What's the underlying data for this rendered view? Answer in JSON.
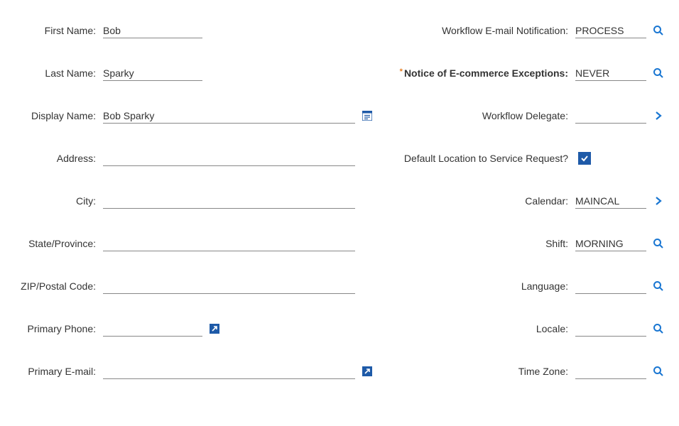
{
  "left": {
    "first_name": {
      "label": "First Name:",
      "value": "Bob"
    },
    "last_name": {
      "label": "Last Name:",
      "value": "Sparky"
    },
    "display_name": {
      "label": "Display Name:",
      "value": "Bob Sparky"
    },
    "address": {
      "label": "Address:",
      "value": ""
    },
    "city": {
      "label": "City:",
      "value": ""
    },
    "state": {
      "label": "State/Province:",
      "value": ""
    },
    "zip": {
      "label": "ZIP/Postal Code:",
      "value": ""
    },
    "primary_phone": {
      "label": "Primary Phone:",
      "value": ""
    },
    "primary_email": {
      "label": "Primary E-mail:",
      "value": ""
    }
  },
  "right": {
    "workflow_email": {
      "label": "Workflow E-mail Notification:",
      "value": "PROCESS"
    },
    "ecommerce_exceptions": {
      "label": "Notice of E-commerce Exceptions:",
      "value": "NEVER",
      "required": "*"
    },
    "workflow_delegate": {
      "label": "Workflow Delegate:",
      "value": ""
    },
    "default_location": {
      "label": "Default Location to Service Request?",
      "checked": true
    },
    "calendar": {
      "label": "Calendar:",
      "value": "MAINCAL"
    },
    "shift": {
      "label": "Shift:",
      "value": "MORNING"
    },
    "language": {
      "label": "Language:",
      "value": ""
    },
    "locale": {
      "label": "Locale:",
      "value": ""
    },
    "timezone": {
      "label": "Time Zone:",
      "value": ""
    }
  }
}
